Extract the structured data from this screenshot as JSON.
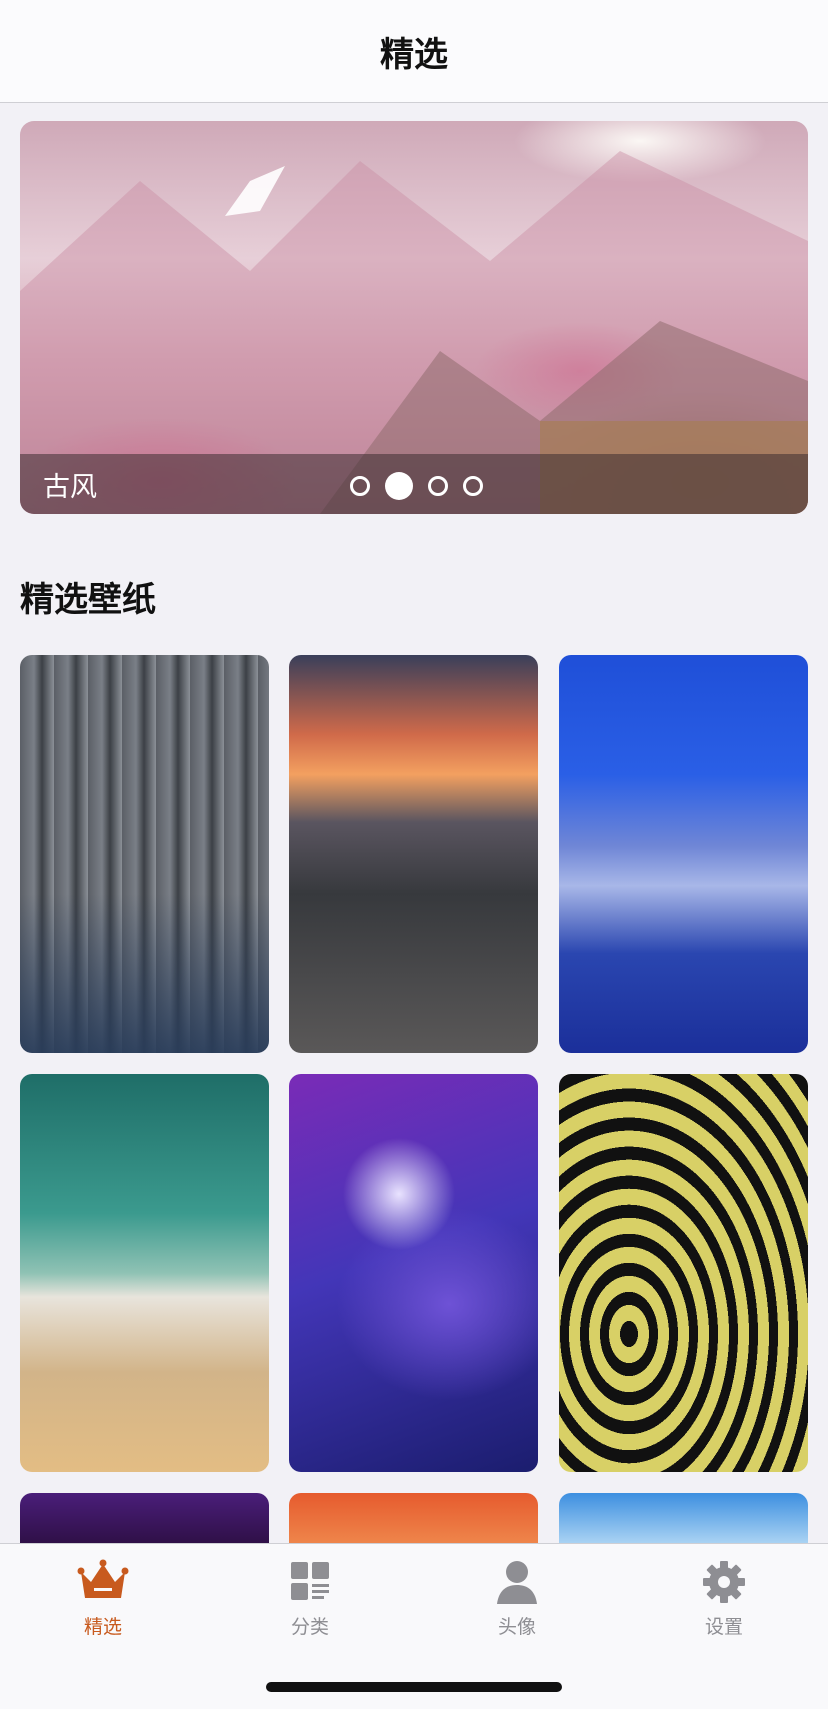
{
  "navbar": {
    "title": "精选"
  },
  "banner": {
    "caption": "古风",
    "page_count": 4,
    "active_page": 2
  },
  "section": {
    "title": "精选壁纸"
  },
  "wallpapers": [
    {
      "name": "city-rooftop"
    },
    {
      "name": "sunset-promenade"
    },
    {
      "name": "blue-skyline"
    },
    {
      "name": "cracked-beach"
    },
    {
      "name": "purple-nebula"
    },
    {
      "name": "zebra-pattern"
    },
    {
      "name": "bokeh"
    },
    {
      "name": "orange-sky"
    },
    {
      "name": "anime-girl"
    }
  ],
  "tabbar": {
    "items": [
      {
        "label": "精选",
        "icon": "crown-icon",
        "active": true
      },
      {
        "label": "分类",
        "icon": "category-grid-icon",
        "active": false
      },
      {
        "label": "头像",
        "icon": "avatar-icon",
        "active": false
      },
      {
        "label": "设置",
        "icon": "gear-icon",
        "active": false
      }
    ]
  },
  "colors": {
    "accent": "#c85a1e",
    "inactive": "#8e8e93",
    "background": "#f2f1f6"
  }
}
